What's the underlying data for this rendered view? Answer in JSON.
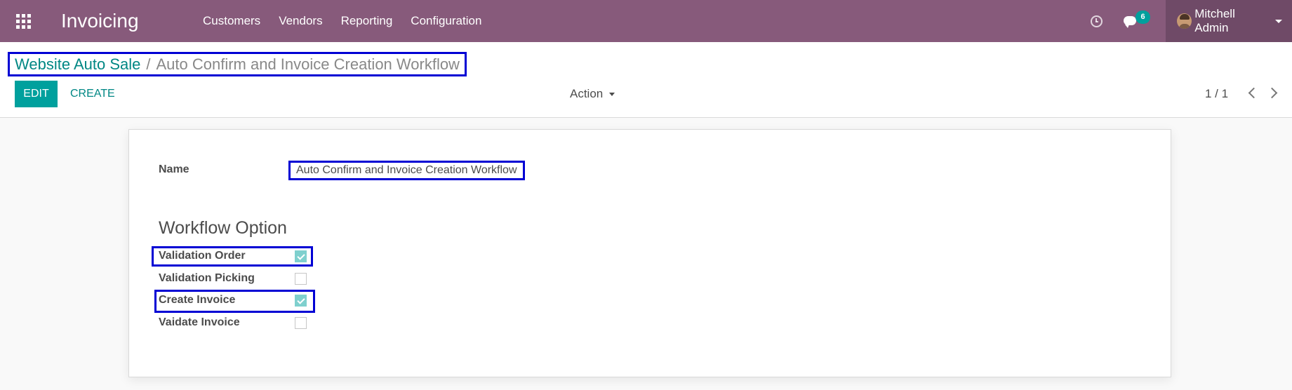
{
  "navbar": {
    "app_name": "Invoicing",
    "menu": [
      "Customers",
      "Vendors",
      "Reporting",
      "Configuration"
    ],
    "messages_count": "6",
    "user_name": "Mitchell Admin"
  },
  "breadcrumb": {
    "parent": "Website Auto Sale",
    "separator": "/",
    "current": "Auto Confirm and Invoice Creation Workflow"
  },
  "toolbar": {
    "edit_label": "EDIT",
    "create_label": "CREATE",
    "action_label": "Action",
    "pager": "1 / 1"
  },
  "form": {
    "name_label": "Name",
    "name_value": "Auto Confirm and Invoice Creation Workflow",
    "section_title": "Workflow Option",
    "options": [
      {
        "label": "Validation Order",
        "checked": true
      },
      {
        "label": "Validation Picking",
        "checked": false
      },
      {
        "label": "Create Invoice",
        "checked": true
      },
      {
        "label": "Vaidate Invoice",
        "checked": false
      }
    ]
  },
  "colors": {
    "navbar": "#875a7b",
    "primary": "#00a09d",
    "highlight_box": "#0000d4"
  }
}
